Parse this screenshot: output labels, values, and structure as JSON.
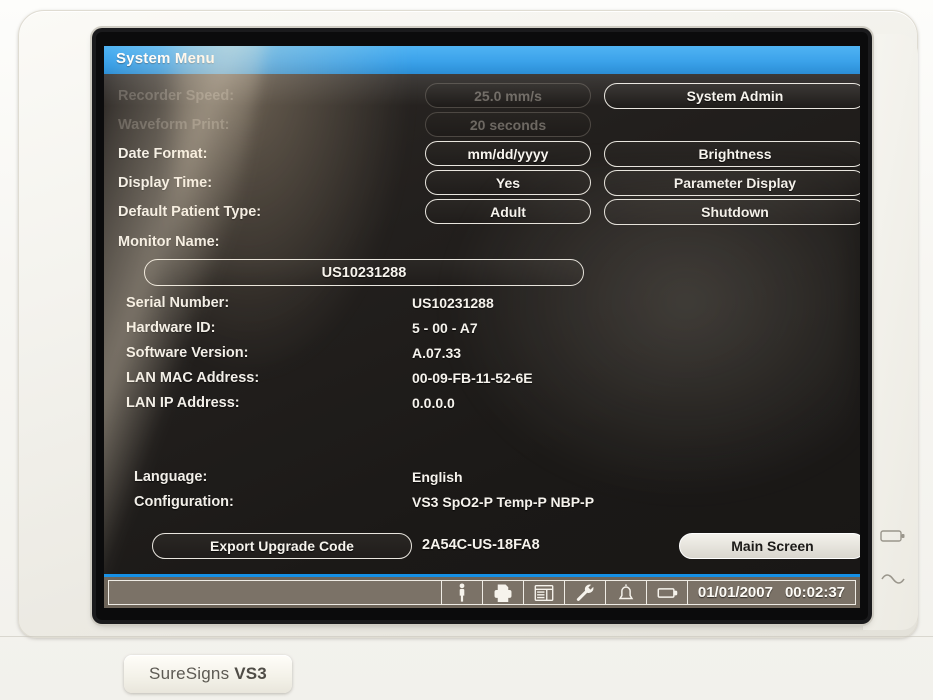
{
  "device": {
    "product_label_1": "SureSigns",
    "product_label_2": "VS3",
    "indicators": [
      "battery-indicator",
      "ac-power-indicator"
    ]
  },
  "screen": {
    "title": "System Menu",
    "settings": [
      {
        "label": "Recorder Speed:",
        "value": "25.0 mm/s",
        "disabled": true
      },
      {
        "label": "Waveform Print:",
        "value": "20 seconds",
        "disabled": true
      },
      {
        "label": "Date Format:",
        "value": "mm/dd/yyyy",
        "disabled": false
      },
      {
        "label": "Display Time:",
        "value": "Yes",
        "disabled": false
      },
      {
        "label": "Default Patient Type:",
        "value": "Adult",
        "disabled": false
      }
    ],
    "right_buttons": [
      {
        "label": "System Admin"
      },
      {
        "label": "Brightness"
      },
      {
        "label": "Parameter Display"
      },
      {
        "label": "Shutdown"
      }
    ],
    "monitor_name": {
      "label": "Monitor Name:",
      "value": "US10231288"
    },
    "info_rows": [
      {
        "label": "Serial Number:",
        "value": "US10231288"
      },
      {
        "label": "Hardware ID:",
        "value": "5 - 00 - A7"
      },
      {
        "label": "Software Version:",
        "value": "A.07.33"
      },
      {
        "label": "LAN MAC Address:",
        "value": "00-09-FB-11-52-6E"
      },
      {
        "label": "LAN IP Address:",
        "value": "0.0.0.0"
      }
    ],
    "locale_rows": [
      {
        "label": "Language:",
        "value": "English"
      },
      {
        "label": "Configuration:",
        "value": "VS3 SpO2-P Temp-P NBP-P"
      }
    ],
    "export_button": "Export Upgrade Code",
    "upgrade_code": "2A54C-US-18FA8",
    "main_screen_button": "Main Screen",
    "statusbar": {
      "icons": [
        "patient-icon",
        "printer-icon",
        "trends-table-icon",
        "wrench-icon",
        "alarm-bell-icon",
        "battery-icon"
      ],
      "date": "01/01/2007",
      "time": "00:02:37"
    },
    "colors": {
      "title_bar": "#1590e6",
      "screen_bg": "#191716",
      "status_bar": "#6d6459",
      "bezel": "#f4f3ee"
    }
  }
}
